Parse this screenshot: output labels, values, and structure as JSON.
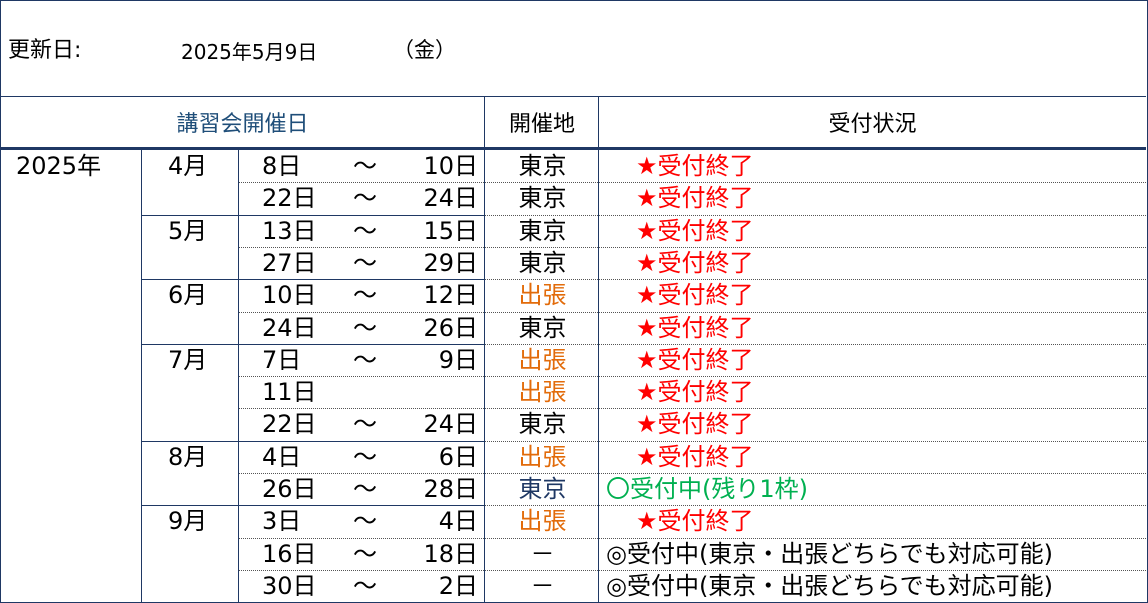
{
  "update": {
    "label": "更新日:",
    "date": "2025年5月9日",
    "dow": "（金）"
  },
  "headers": {
    "dates": "講習会開催日",
    "venue": "開催地",
    "status": "受付状況"
  },
  "year": "2025年",
  "months": [
    "4月",
    "5月",
    "6月",
    "7月",
    "8月",
    "9月"
  ],
  "rows": [
    {
      "start": "8日",
      "tilde": "～",
      "end": "10日",
      "venue": "東京",
      "status": "★受付終了"
    },
    {
      "start": "22日",
      "tilde": "～",
      "end": "24日",
      "venue": "東京",
      "status": "★受付終了"
    },
    {
      "start": "13日",
      "tilde": "～",
      "end": "15日",
      "venue": "東京",
      "status": "★受付終了"
    },
    {
      "start": "27日",
      "tilde": "～",
      "end": "29日",
      "venue": "東京",
      "status": "★受付終了"
    },
    {
      "start": "10日",
      "tilde": "～",
      "end": "12日",
      "venue": "出張",
      "status": "★受付終了"
    },
    {
      "start": "24日",
      "tilde": "～",
      "end": "26日",
      "venue": "東京",
      "status": "★受付終了"
    },
    {
      "start": "7日",
      "tilde": "～",
      "end": "9日",
      "venue": "出張",
      "status": "★受付終了"
    },
    {
      "start": "11日",
      "tilde": "",
      "end": "",
      "venue": "出張",
      "status": "★受付終了"
    },
    {
      "start": "22日",
      "tilde": "～",
      "end": "24日",
      "venue": "東京",
      "status": "★受付終了"
    },
    {
      "start": "4日",
      "tilde": "～",
      "end": "6日",
      "venue": "出張",
      "status": "★受付終了"
    },
    {
      "start": "26日",
      "tilde": "～",
      "end": "28日",
      "venue": "東京",
      "status": "〇受付中(残り1枠)"
    },
    {
      "start": "3日",
      "tilde": "～",
      "end": "4日",
      "venue": "出張",
      "status": "★受付終了"
    },
    {
      "start": "16日",
      "tilde": "～",
      "end": "18日",
      "venue": "－",
      "status": "◎受付中(東京・出張どちらでも対応可能)"
    },
    {
      "start": "30日",
      "tilde": "～",
      "end": "2日",
      "venue": "－",
      "status": "◎受付中(東京・出張どちらでも対応可能)"
    }
  ],
  "colors": {
    "border": "#1f3864",
    "closed": "#ff0000",
    "dispatch": "#e26b0a",
    "open": "#00b050",
    "header_text": "#1f4e79"
  }
}
